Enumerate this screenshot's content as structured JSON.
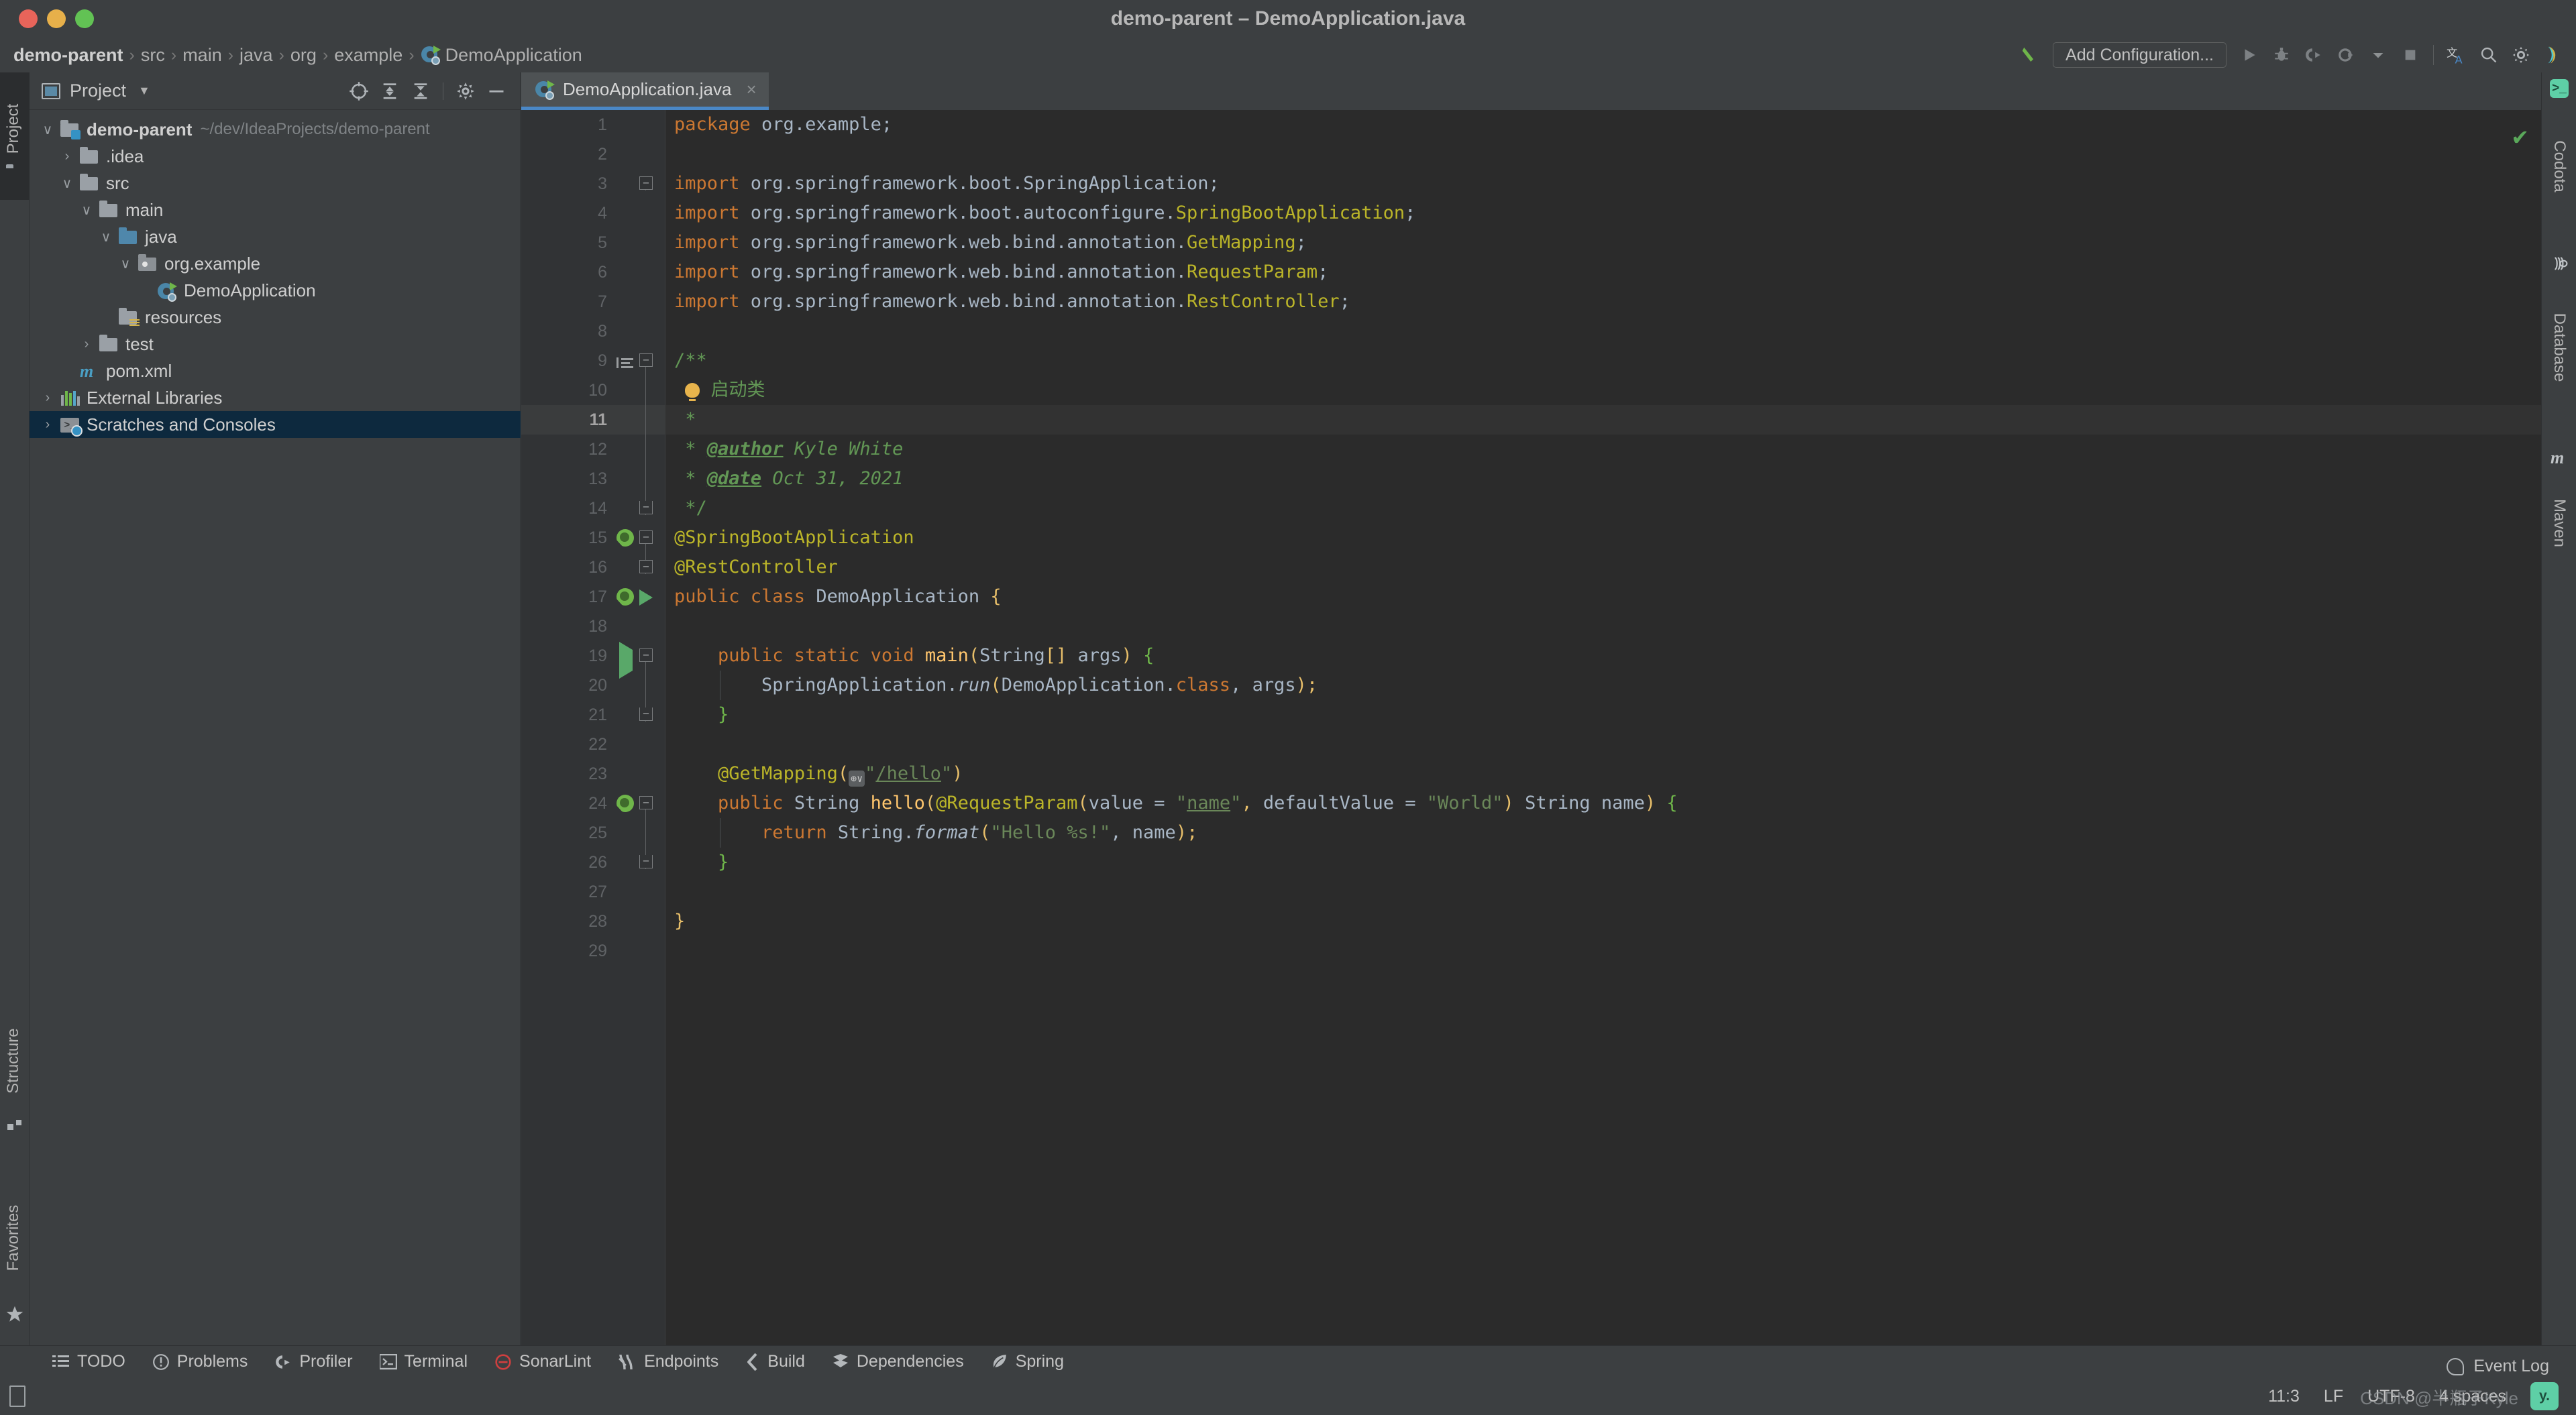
{
  "window": {
    "title": "demo-parent – DemoApplication.java"
  },
  "breadcrumb": {
    "items": [
      "demo-parent",
      "src",
      "main",
      "java",
      "org",
      "example",
      "DemoApplication"
    ],
    "separator": "›"
  },
  "toolbar": {
    "add_configuration_label": "Add Configuration...",
    "icons": [
      "build-hammer-icon",
      "run-icon",
      "debug-icon",
      "run-coverage-icon",
      "profile-icon",
      "stop-icon",
      "translate-icon",
      "search-icon",
      "settings-gear-icon",
      "jetbrains-toolbox-icon"
    ]
  },
  "left_strip": {
    "top_tool": "Project",
    "bottom_tools": [
      "Structure",
      "Favorites"
    ]
  },
  "right_strip": {
    "tools": [
      "Codota",
      "Database",
      "Maven"
    ]
  },
  "project_panel": {
    "title": "Project",
    "tool_icons": [
      "locate-icon",
      "expand-all-icon",
      "collapse-all-icon",
      "settings-gear-icon",
      "hide-icon"
    ],
    "tree": [
      {
        "label": "demo-parent",
        "path": "~/dev/IdeaProjects/demo-parent",
        "depth": 0,
        "twisty": "∨",
        "icon": "module-folder",
        "bold": true,
        "selected": false
      },
      {
        "label": ".idea",
        "path": "",
        "depth": 1,
        "twisty": "›",
        "icon": "folder",
        "bold": false,
        "selected": false
      },
      {
        "label": "src",
        "path": "",
        "depth": 1,
        "twisty": "∨",
        "icon": "folder",
        "bold": false,
        "selected": false
      },
      {
        "label": "main",
        "path": "",
        "depth": 2,
        "twisty": "∨",
        "icon": "folder",
        "bold": false,
        "selected": false
      },
      {
        "label": "java",
        "path": "",
        "depth": 3,
        "twisty": "∨",
        "icon": "source-folder",
        "bold": false,
        "selected": false
      },
      {
        "label": "org.example",
        "path": "",
        "depth": 4,
        "twisty": "∨",
        "icon": "package",
        "bold": false,
        "selected": false
      },
      {
        "label": "DemoApplication",
        "path": "",
        "depth": 5,
        "twisty": "",
        "icon": "spring-boot-class",
        "bold": false,
        "selected": false
      },
      {
        "label": "resources",
        "path": "",
        "depth": 3,
        "twisty": "",
        "icon": "resource-folder",
        "bold": false,
        "selected": false
      },
      {
        "label": "test",
        "path": "",
        "depth": 2,
        "twisty": "›",
        "icon": "folder",
        "bold": false,
        "selected": false
      },
      {
        "label": "pom.xml",
        "path": "",
        "depth": 1,
        "twisty": "",
        "icon": "maven-file",
        "bold": false,
        "selected": false
      },
      {
        "label": "External Libraries",
        "path": "",
        "depth": 0,
        "twisty": "›",
        "icon": "libraries",
        "bold": false,
        "selected": false
      },
      {
        "label": "Scratches and Consoles",
        "path": "",
        "depth": 0,
        "twisty": "›",
        "icon": "scratches",
        "bold": false,
        "selected": true
      }
    ]
  },
  "editor": {
    "tab_label": "DemoApplication.java",
    "tab_close": "×",
    "inspection_status": "✔",
    "caret_line": 11,
    "lines": [
      {
        "n": 1,
        "gutter": "",
        "fold": "",
        "tokens": [
          {
            "t": "package ",
            "c": "kw"
          },
          {
            "t": "org.example;",
            "c": "id"
          }
        ]
      },
      {
        "n": 2,
        "gutter": "",
        "fold": "",
        "tokens": []
      },
      {
        "n": 3,
        "gutter": "",
        "fold": "minus",
        "tokens": [
          {
            "t": "import ",
            "c": "kw"
          },
          {
            "t": "org.springframework.boot.",
            "c": "id"
          },
          {
            "t": "SpringApplication",
            "c": "id"
          },
          {
            "t": ";",
            "c": "id"
          }
        ]
      },
      {
        "n": 4,
        "gutter": "",
        "fold": "",
        "tokens": [
          {
            "t": "import ",
            "c": "kw"
          },
          {
            "t": "org.springframework.boot.autoconfigure.",
            "c": "id"
          },
          {
            "t": "SpringBootApplication",
            "c": "ann"
          },
          {
            "t": ";",
            "c": "id"
          }
        ]
      },
      {
        "n": 5,
        "gutter": "",
        "fold": "",
        "tokens": [
          {
            "t": "import ",
            "c": "kw"
          },
          {
            "t": "org.springframework.web.bind.annotation.",
            "c": "id"
          },
          {
            "t": "GetMapping",
            "c": "ann"
          },
          {
            "t": ";",
            "c": "id"
          }
        ]
      },
      {
        "n": 6,
        "gutter": "",
        "fold": "",
        "tokens": [
          {
            "t": "import ",
            "c": "kw"
          },
          {
            "t": "org.springframework.web.bind.annotation.",
            "c": "id"
          },
          {
            "t": "RequestParam",
            "c": "ann"
          },
          {
            "t": ";",
            "c": "id"
          }
        ]
      },
      {
        "n": 7,
        "gutter": "",
        "fold": "",
        "tokens": [
          {
            "t": "import ",
            "c": "kw"
          },
          {
            "t": "org.springframework.web.bind.annotation.",
            "c": "id"
          },
          {
            "t": "RestController",
            "c": "ann"
          },
          {
            "t": ";",
            "c": "id"
          }
        ]
      },
      {
        "n": 8,
        "gutter": "",
        "fold": "",
        "tokens": []
      },
      {
        "n": 9,
        "gutter": "doc-lines",
        "fold": "minus",
        "tokens": [
          {
            "t": "/**",
            "c": "cmt"
          }
        ]
      },
      {
        "n": 10,
        "gutter": "",
        "fold": "",
        "tokens": [
          {
            "t": " ",
            "c": "cmt"
          },
          {
            "t": "@@BULB@@",
            "c": "bulb"
          },
          {
            "t": " 启动类",
            "c": "cmt"
          }
        ]
      },
      {
        "n": 11,
        "gutter": "",
        "fold": "",
        "tokens": [
          {
            "t": " *",
            "c": "cmt"
          }
        ]
      },
      {
        "n": 12,
        "gutter": "",
        "fold": "",
        "tokens": [
          {
            "t": " * ",
            "c": "cmt"
          },
          {
            "t": "@author",
            "c": "jtag"
          },
          {
            "t": " Kyle White",
            "c": "cmtt"
          }
        ]
      },
      {
        "n": 13,
        "gutter": "",
        "fold": "",
        "tokens": [
          {
            "t": " * ",
            "c": "cmt"
          },
          {
            "t": "@date",
            "c": "jtag"
          },
          {
            "t": " Oct 31, 2021",
            "c": "cmtt"
          }
        ]
      },
      {
        "n": 14,
        "gutter": "",
        "fold": "plus",
        "tokens": [
          {
            "t": " */",
            "c": "cmt"
          }
        ]
      },
      {
        "n": 15,
        "gutter": "bean-search",
        "fold": "minus",
        "tokens": [
          {
            "t": "@SpringBootApplication",
            "c": "ann"
          }
        ]
      },
      {
        "n": 16,
        "gutter": "",
        "fold": "minus",
        "tokens": [
          {
            "t": "@RestController",
            "c": "ann"
          }
        ]
      },
      {
        "n": 17,
        "gutter": "bean-run",
        "fold": "",
        "tokens": [
          {
            "t": "public class ",
            "c": "kw"
          },
          {
            "t": "DemoApplication ",
            "c": "id"
          },
          {
            "t": "{",
            "c": "bry"
          }
        ]
      },
      {
        "n": 18,
        "gutter": "",
        "fold": "",
        "tokens": []
      },
      {
        "n": 19,
        "gutter": "run",
        "fold": "minus",
        "tokens": [
          {
            "t": "    public static void ",
            "c": "kw"
          },
          {
            "t": "main",
            "c": "mth"
          },
          {
            "t": "(",
            "c": "bry"
          },
          {
            "t": "String",
            "c": "id"
          },
          {
            "t": "[] ",
            "c": "bry"
          },
          {
            "t": "args",
            "c": "id"
          },
          {
            "t": ")",
            "c": "bry"
          },
          {
            "t": " ",
            "c": "id"
          },
          {
            "t": "{",
            "c": "brg"
          }
        ]
      },
      {
        "n": 20,
        "gutter": "",
        "fold": "",
        "tokens": [
          {
            "t": "        SpringApplication.",
            "c": "id"
          },
          {
            "t": "run",
            "c": "ital"
          },
          {
            "t": "(",
            "c": "bry"
          },
          {
            "t": "DemoApplication.",
            "c": "id"
          },
          {
            "t": "class",
            "c": "kw"
          },
          {
            "t": ", args",
            "c": "id"
          },
          {
            "t": ")",
            "c": "bry"
          },
          {
            "t": ";",
            "c": "bry"
          }
        ]
      },
      {
        "n": 21,
        "gutter": "",
        "fold": "plus",
        "tokens": [
          {
            "t": "    ",
            "c": "id"
          },
          {
            "t": "}",
            "c": "brg"
          }
        ]
      },
      {
        "n": 22,
        "gutter": "",
        "fold": "",
        "tokens": []
      },
      {
        "n": 23,
        "gutter": "",
        "fold": "",
        "tokens": [
          {
            "t": "    ",
            "c": "id"
          },
          {
            "t": "@GetMapping",
            "c": "ann"
          },
          {
            "t": "(",
            "c": "bry"
          },
          {
            "t": "@@GLOBE@@",
            "c": "globe"
          },
          {
            "t": "\"",
            "c": "str"
          },
          {
            "t": "/hello",
            "c": "strul"
          },
          {
            "t": "\"",
            "c": "str"
          },
          {
            "t": ")",
            "c": "bry"
          }
        ]
      },
      {
        "n": 24,
        "gutter": "bean",
        "fold": "minus",
        "tokens": [
          {
            "t": "    public ",
            "c": "kw"
          },
          {
            "t": "String ",
            "c": "id"
          },
          {
            "t": "hello",
            "c": "mth"
          },
          {
            "t": "(",
            "c": "bry"
          },
          {
            "t": "@RequestParam",
            "c": "ann"
          },
          {
            "t": "(",
            "c": "bry"
          },
          {
            "t": "value",
            "c": "id"
          },
          {
            "t": " = ",
            "c": "id"
          },
          {
            "t": "\"",
            "c": "str"
          },
          {
            "t": "name",
            "c": "strul"
          },
          {
            "t": "\"",
            "c": "str"
          },
          {
            "t": ", ",
            "c": "bry"
          },
          {
            "t": "defaultValue",
            "c": "id"
          },
          {
            "t": " = ",
            "c": "id"
          },
          {
            "t": "\"World\"",
            "c": "str"
          },
          {
            "t": ")",
            "c": "bry"
          },
          {
            "t": " String name",
            "c": "id"
          },
          {
            "t": ")",
            "c": "bry"
          },
          {
            "t": " ",
            "c": "id"
          },
          {
            "t": "{",
            "c": "brg"
          }
        ]
      },
      {
        "n": 25,
        "gutter": "",
        "fold": "",
        "tokens": [
          {
            "t": "        ",
            "c": "id"
          },
          {
            "t": "return ",
            "c": "kw"
          },
          {
            "t": "String.",
            "c": "id"
          },
          {
            "t": "format",
            "c": "ital"
          },
          {
            "t": "(",
            "c": "bry"
          },
          {
            "t": "\"Hello %s!\"",
            "c": "str"
          },
          {
            "t": ", name",
            "c": "id"
          },
          {
            "t": ")",
            "c": "bry"
          },
          {
            "t": ";",
            "c": "bry"
          }
        ]
      },
      {
        "n": 26,
        "gutter": "",
        "fold": "plus",
        "tokens": [
          {
            "t": "    ",
            "c": "id"
          },
          {
            "t": "}",
            "c": "brg"
          }
        ]
      },
      {
        "n": 27,
        "gutter": "",
        "fold": "",
        "tokens": []
      },
      {
        "n": 28,
        "gutter": "",
        "fold": "",
        "tokens": [
          {
            "t": "}",
            "c": "bry"
          }
        ]
      },
      {
        "n": 29,
        "gutter": "",
        "fold": "",
        "tokens": []
      }
    ]
  },
  "bottom_tools": [
    {
      "label": "TODO",
      "icon": "todo-list-icon"
    },
    {
      "label": "Problems",
      "icon": "problems-icon"
    },
    {
      "label": "Profiler",
      "icon": "profiler-icon"
    },
    {
      "label": "Terminal",
      "icon": "terminal-icon"
    },
    {
      "label": "SonarLint",
      "icon": "sonarlint-icon"
    },
    {
      "label": "Endpoints",
      "icon": "endpoints-icon"
    },
    {
      "label": "Build",
      "icon": "build-icon"
    },
    {
      "label": "Dependencies",
      "icon": "dependencies-icon"
    },
    {
      "label": "Spring",
      "icon": "spring-leaf-icon"
    }
  ],
  "statusbar": {
    "event_log": "Event Log",
    "caret_position": "11:3",
    "line_separator": "LF",
    "encoding": "UTF-8",
    "indent": "4 spaces",
    "avatar_initials": "y.",
    "watermark": "CSDN @半瓶子Kyle"
  },
  "colors": {
    "accent_blue": "#4a88c7",
    "selection_blue": "#0d293e",
    "editor_bg": "#2b2b2b",
    "panel_bg": "#3c3f41",
    "gutter_bg": "#313335",
    "keyword": "#cc7832",
    "identifier": "#a9b7c6",
    "annotation": "#bbb529",
    "string": "#6a8759",
    "comment": "#629755",
    "method": "#ffc66d",
    "green_run": "#59a869"
  }
}
